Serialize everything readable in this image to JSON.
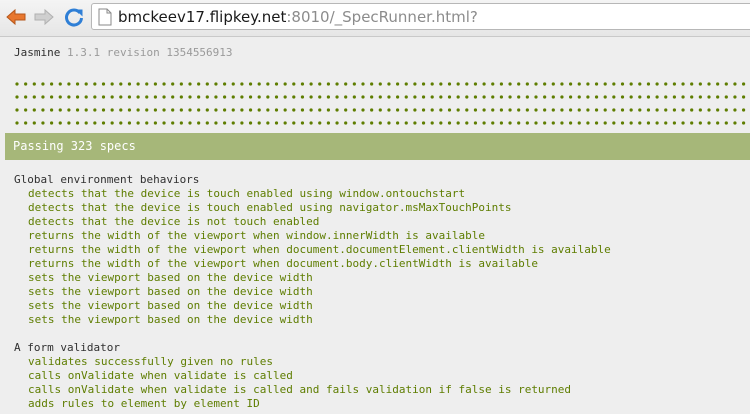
{
  "browser": {
    "url_host": "bmckeev17.flipkey.net",
    "url_rest": ":8010/_SpecRunner.html?"
  },
  "jasmine": {
    "title": "Jasmine",
    "version": "1.3.1 revision 1354556913",
    "dot_color": "#5e7d00",
    "status_bar_color": "#a6b779",
    "summary": "Passing 323 specs",
    "suites": [
      {
        "name": "Global environment behaviors",
        "specs": [
          "detects that the device is touch enabled using window.ontouchstart",
          "detects that the device is touch enabled using navigator.msMaxTouchPoints",
          "detects that the device is not touch enabled",
          "returns the width of the viewport when window.innerWidth is available",
          "returns the width of the viewport when document.documentElement.clientWidth is available",
          "returns the width of the viewport when document.body.clientWidth is available",
          "sets the viewport based on the device width",
          "sets the viewport based on the device width",
          "sets the viewport based on the device width",
          "sets the viewport based on the device width"
        ]
      },
      {
        "name": "A form validator",
        "specs": [
          "validates successfully given no rules",
          "calls onValidate when validate is called",
          "calls onValidate when validate is called and fails validation if false is returned",
          "adds rules to element by element ID"
        ]
      }
    ]
  }
}
